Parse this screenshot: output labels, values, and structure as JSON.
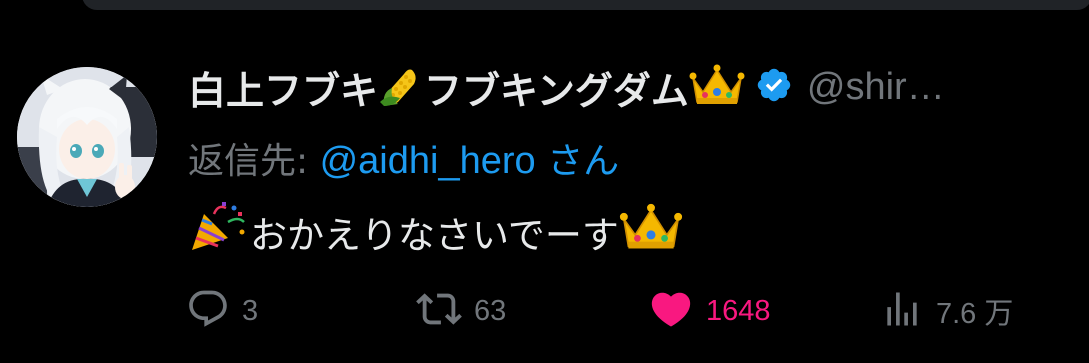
{
  "tweet": {
    "display_name_part1": "白上フブキ",
    "display_name_part2": "フブキングダム",
    "handle": "@shir…",
    "reply_prefix": "返信先: ",
    "reply_mention": "@aidhi_hero",
    "reply_suffix": " さん",
    "text": "おかえりなさいでーす",
    "icons": {
      "name_emoji_1": "corn-emoji",
      "name_emoji_2": "crown-emoji",
      "verified": "verified-badge-icon",
      "text_emoji_start": "party-popper-emoji",
      "text_emoji_end": "crown-emoji"
    }
  },
  "actions": {
    "reply_count": "3",
    "retweet_count": "63",
    "like_count": "1648",
    "views_count": "7.6 万",
    "icons": [
      "reply-icon",
      "retweet-icon",
      "heart-icon",
      "views-icon"
    ]
  },
  "colors": {
    "background": "#000000",
    "text_primary": "#e7e9ea",
    "text_secondary": "#71767b",
    "link": "#1d9bf0",
    "like": "#f91880"
  }
}
